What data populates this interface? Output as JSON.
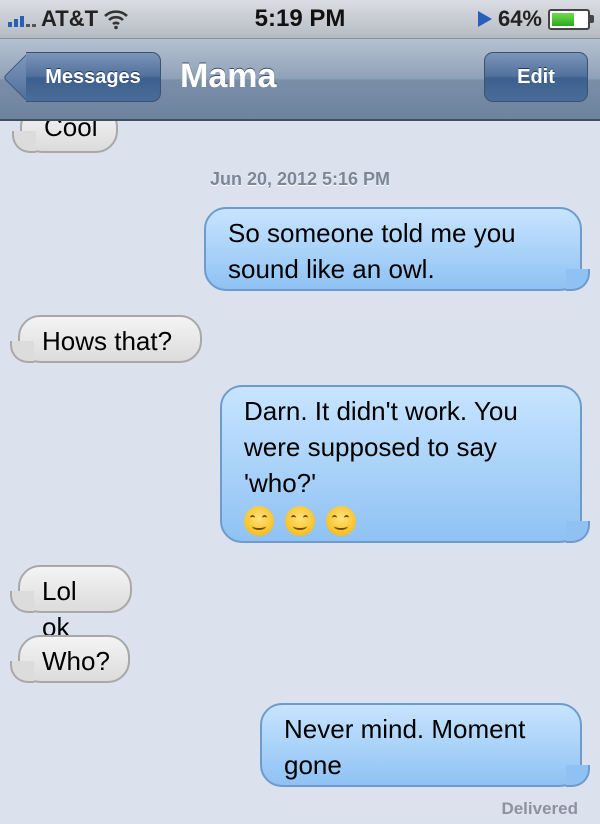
{
  "status_bar": {
    "carrier": "AT&T",
    "time": "5:19 PM",
    "battery": "64%",
    "battery_level": 0.64,
    "icons": [
      "signal-icon",
      "wifi-icon",
      "location-icon",
      "battery-icon"
    ]
  },
  "nav": {
    "back_label": "Messages",
    "title": "Mama",
    "edit_label": "Edit"
  },
  "conversation": {
    "timestamp": "Jun 20, 2012 5:16 PM",
    "messages": [
      {
        "side": "incoming",
        "text": "Cool"
      },
      {
        "side": "outgoing",
        "lines": [
          "So someone told me you",
          "sound like an owl."
        ]
      },
      {
        "side": "incoming",
        "text": "Hows that?"
      },
      {
        "side": "outgoing",
        "lines": [
          "Darn. It didn't work. You",
          "were supposed to say",
          "'who?'"
        ],
        "emoji": [
          "smiling-face-emoji",
          "smiling-face-emoji",
          "smiling-face-emoji"
        ]
      },
      {
        "side": "incoming",
        "text": "Lol ok"
      },
      {
        "side": "incoming",
        "text": "Who?"
      },
      {
        "side": "outgoing",
        "lines": [
          "Never mind. Moment",
          "gone"
        ]
      }
    ],
    "delivered": "Delivered"
  },
  "colors": {
    "background": "#dbe2ed",
    "outgoing_bubble": "#a9d2fa",
    "incoming_bubble": "#e8e8e8",
    "nav_bar": "#8fa1b8"
  }
}
